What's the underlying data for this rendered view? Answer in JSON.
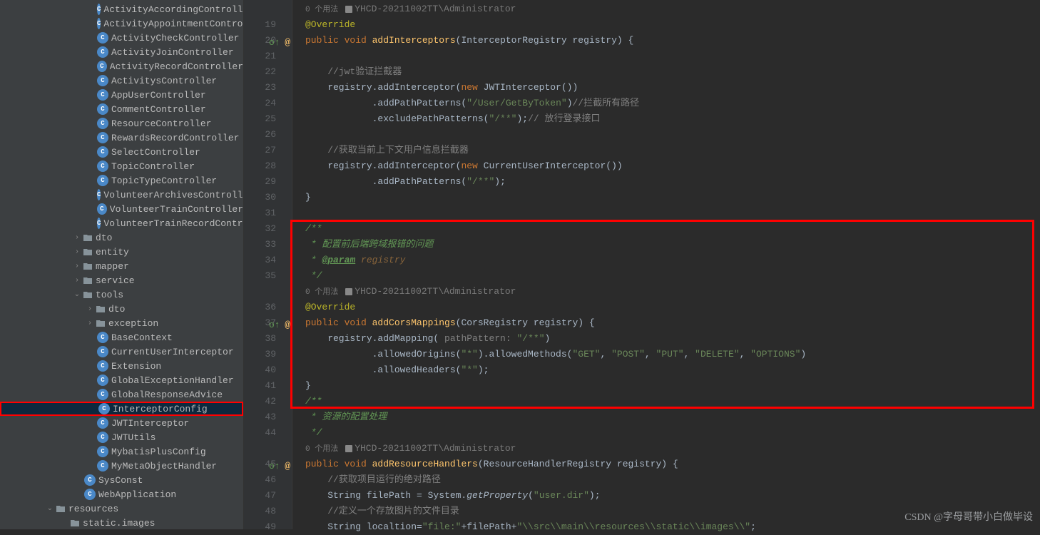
{
  "sidebar": [
    {
      "indent": 136,
      "icon": "c",
      "label": "ActivityAccordingController"
    },
    {
      "indent": 136,
      "icon": "c",
      "label": "ActivityAppointmentController"
    },
    {
      "indent": 136,
      "icon": "c",
      "label": "ActivityCheckController"
    },
    {
      "indent": 136,
      "icon": "c",
      "label": "ActivityJoinController"
    },
    {
      "indent": 136,
      "icon": "c",
      "label": "ActivityRecordController"
    },
    {
      "indent": 136,
      "icon": "c",
      "label": "ActivitysController"
    },
    {
      "indent": 136,
      "icon": "c",
      "label": "AppUserController"
    },
    {
      "indent": 136,
      "icon": "c",
      "label": "CommentController"
    },
    {
      "indent": 136,
      "icon": "c",
      "label": "ResourceController"
    },
    {
      "indent": 136,
      "icon": "c",
      "label": "RewardsRecordController"
    },
    {
      "indent": 136,
      "icon": "c",
      "label": "SelectController"
    },
    {
      "indent": 136,
      "icon": "c",
      "label": "TopicController"
    },
    {
      "indent": 136,
      "icon": "c",
      "label": "TopicTypeController"
    },
    {
      "indent": 136,
      "icon": "c",
      "label": "VolunteerArchivesController"
    },
    {
      "indent": 136,
      "icon": "c",
      "label": "VolunteerTrainController"
    },
    {
      "indent": 136,
      "icon": "c",
      "label": "VolunteerTrainRecordController"
    },
    {
      "indent": 100,
      "chev": ">",
      "icon": "dir",
      "label": "dto"
    },
    {
      "indent": 100,
      "chev": ">",
      "icon": "dir",
      "label": "entity"
    },
    {
      "indent": 100,
      "chev": ">",
      "icon": "dir",
      "label": "mapper"
    },
    {
      "indent": 100,
      "chev": ">",
      "icon": "dir",
      "label": "service"
    },
    {
      "indent": 100,
      "chev": "v",
      "icon": "dir",
      "label": "tools"
    },
    {
      "indent": 118,
      "chev": ">",
      "icon": "dir",
      "label": "dto"
    },
    {
      "indent": 118,
      "chev": ">",
      "icon": "dir",
      "label": "exception"
    },
    {
      "indent": 136,
      "icon": "c",
      "label": "BaseContext"
    },
    {
      "indent": 136,
      "icon": "c",
      "label": "CurrentUserInterceptor"
    },
    {
      "indent": 136,
      "icon": "c",
      "label": "Extension"
    },
    {
      "indent": 136,
      "icon": "c",
      "label": "GlobalExceptionHandler"
    },
    {
      "indent": 136,
      "icon": "c",
      "label": "GlobalResponseAdvice"
    },
    {
      "indent": 136,
      "icon": "c",
      "label": "InterceptorConfig",
      "selected": true
    },
    {
      "indent": 136,
      "icon": "c",
      "label": "JWTInterceptor"
    },
    {
      "indent": 136,
      "icon": "c",
      "label": "JWTUtils"
    },
    {
      "indent": 136,
      "icon": "c",
      "label": "MybatisPlusConfig"
    },
    {
      "indent": 136,
      "icon": "c",
      "label": "MyMetaObjectHandler"
    },
    {
      "indent": 118,
      "icon": "c",
      "label": "SysConst"
    },
    {
      "indent": 118,
      "icon": "c",
      "label": "WebApplication"
    },
    {
      "indent": 62,
      "chev": "v",
      "icon": "dir",
      "label": "resources"
    },
    {
      "indent": 98,
      "icon": "dir",
      "label": "static.images"
    }
  ],
  "lines": [
    {
      "n": "",
      "type": "usage",
      "usages": "0 个用法",
      "author": "YHCD-20211002TT\\Administrator"
    },
    {
      "n": "19",
      "html": "<span class='ann'>@Override</span>"
    },
    {
      "n": "20",
      "mark": "ov",
      "html": "<span class='kw'>public void </span><span class='fn'>addInterceptors</span>(InterceptorRegistry registry) {"
    },
    {
      "n": "21",
      "html": ""
    },
    {
      "n": "22",
      "html": "    <span class='cmt'>//jwt验证拦截器</span>"
    },
    {
      "n": "23",
      "html": "    registry.addInterceptor(<span class='kw'>new</span> JWTInterceptor())"
    },
    {
      "n": "24",
      "html": "            .addPathPatterns(<span class='str'>\"/User/GetByToken\"</span>)<span class='cmt'>//拦截所有路径</span>"
    },
    {
      "n": "25",
      "html": "            .excludePathPatterns(<span class='str'>\"/**\"</span>);<span class='cmt'>// 放行登录接口</span>"
    },
    {
      "n": "26",
      "html": ""
    },
    {
      "n": "27",
      "html": "    <span class='cmt'>//获取当前上下文用户信息拦截器</span>"
    },
    {
      "n": "28",
      "html": "    registry.addInterceptor(<span class='kw'>new</span> CurrentUserInterceptor())"
    },
    {
      "n": "29",
      "html": "            .addPathPatterns(<span class='str'>\"/**\"</span>);"
    },
    {
      "n": "30",
      "html": "}"
    },
    {
      "n": "31",
      "html": ""
    },
    {
      "n": "32",
      "html": "<span class='cmtdoc'>/**</span>"
    },
    {
      "n": "33",
      "html": "<span class='cmtdoc'> * 配置前后端跨域报错的问题</span>"
    },
    {
      "n": "34",
      "html": "<span class='cmtdoc'> * </span><span class='doctag'>@param</span> <span class='param'>registry</span>"
    },
    {
      "n": "35",
      "html": "<span class='cmtdoc'> */</span>"
    },
    {
      "n": "",
      "type": "usage",
      "usages": "0 个用法",
      "author": "YHCD-20211002TT\\Administrator"
    },
    {
      "n": "36",
      "html": "<span class='ann'>@Override</span>"
    },
    {
      "n": "37",
      "mark": "ov",
      "html": "<span class='kw'>public void </span><span class='fn'>addCorsMappings</span>(CorsRegistry registry) {"
    },
    {
      "n": "38",
      "html": "    registry.addMapping( <span class='cmt'>pathPattern:</span> <span class='str'>\"/**\"</span>)"
    },
    {
      "n": "39",
      "html": "            .allowedOrigins(<span class='str'>\"*\"</span>).allowedMethods(<span class='str'>\"GET\"</span>, <span class='str'>\"POST\"</span>, <span class='str'>\"PUT\"</span>, <span class='str'>\"DELETE\"</span>, <span class='str'>\"OPTIONS\"</span>)"
    },
    {
      "n": "40",
      "html": "            .allowedHeaders(<span class='str'>\"*\"</span>);"
    },
    {
      "n": "41",
      "html": "}"
    },
    {
      "n": "42",
      "html": "<span class='cmtdoc'>/**</span>"
    },
    {
      "n": "43",
      "html": "<span class='cmtdoc'> * 资源的配置处理</span>"
    },
    {
      "n": "44",
      "html": "<span class='cmtdoc'> */</span>"
    },
    {
      "n": "",
      "type": "usage",
      "usages": "0 个用法",
      "author": "YHCD-20211002TT\\Administrator"
    },
    {
      "n": "45",
      "mark": "ov",
      "html": "<span class='kw'>public void </span><span class='fn'>addResourceHandlers</span>(ResourceHandlerRegistry registry) {"
    },
    {
      "n": "46",
      "html": "    <span class='cmt'>//获取项目运行的绝对路径</span>"
    },
    {
      "n": "47",
      "html": "    String filePath = System.<span class='it'>getProperty</span>(<span class='str'>\"user.dir\"</span>);"
    },
    {
      "n": "48",
      "html": "    <span class='cmt'>//定义一个存放图片的文件目录</span>"
    },
    {
      "n": "49",
      "html": "    String localtion=<span class='str'>\"file:\"</span>+filePath+<span class='str'>\"\\\\src\\\\main\\\\resources\\\\static\\\\images\\\\\"</span>;"
    }
  ],
  "watermark": "CSDN @字母哥带小白做毕设"
}
